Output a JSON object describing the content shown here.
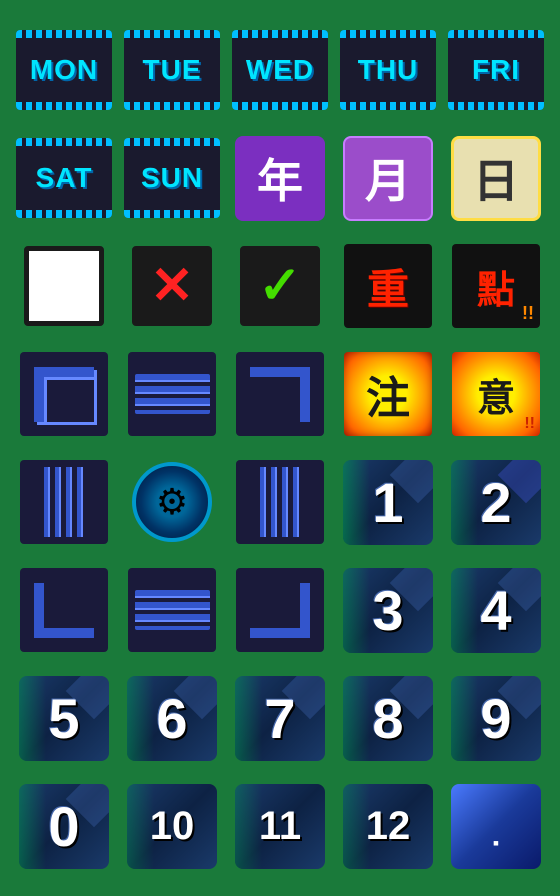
{
  "days": [
    "MON",
    "TUE",
    "WED",
    "THU",
    "FRI",
    "SAT",
    "SUN"
  ],
  "cn_chars": [
    "年",
    "月",
    "日"
  ],
  "cn_words": [
    "重",
    "點",
    "注",
    "意"
  ],
  "numbers": [
    "1",
    "2",
    "3",
    "4",
    "5",
    "6",
    "7",
    "8",
    "9",
    "0",
    "10",
    "11",
    "12",
    "."
  ],
  "labels": {
    "mon": "MON",
    "tue": "TUE",
    "wed": "WED",
    "thu": "THU",
    "fri": "FRI",
    "sat": "SAT",
    "sun": "SUN",
    "year": "年",
    "month": "月",
    "day": "日",
    "chong": "重",
    "dian": "點",
    "zhu": "注",
    "yi": "意"
  }
}
